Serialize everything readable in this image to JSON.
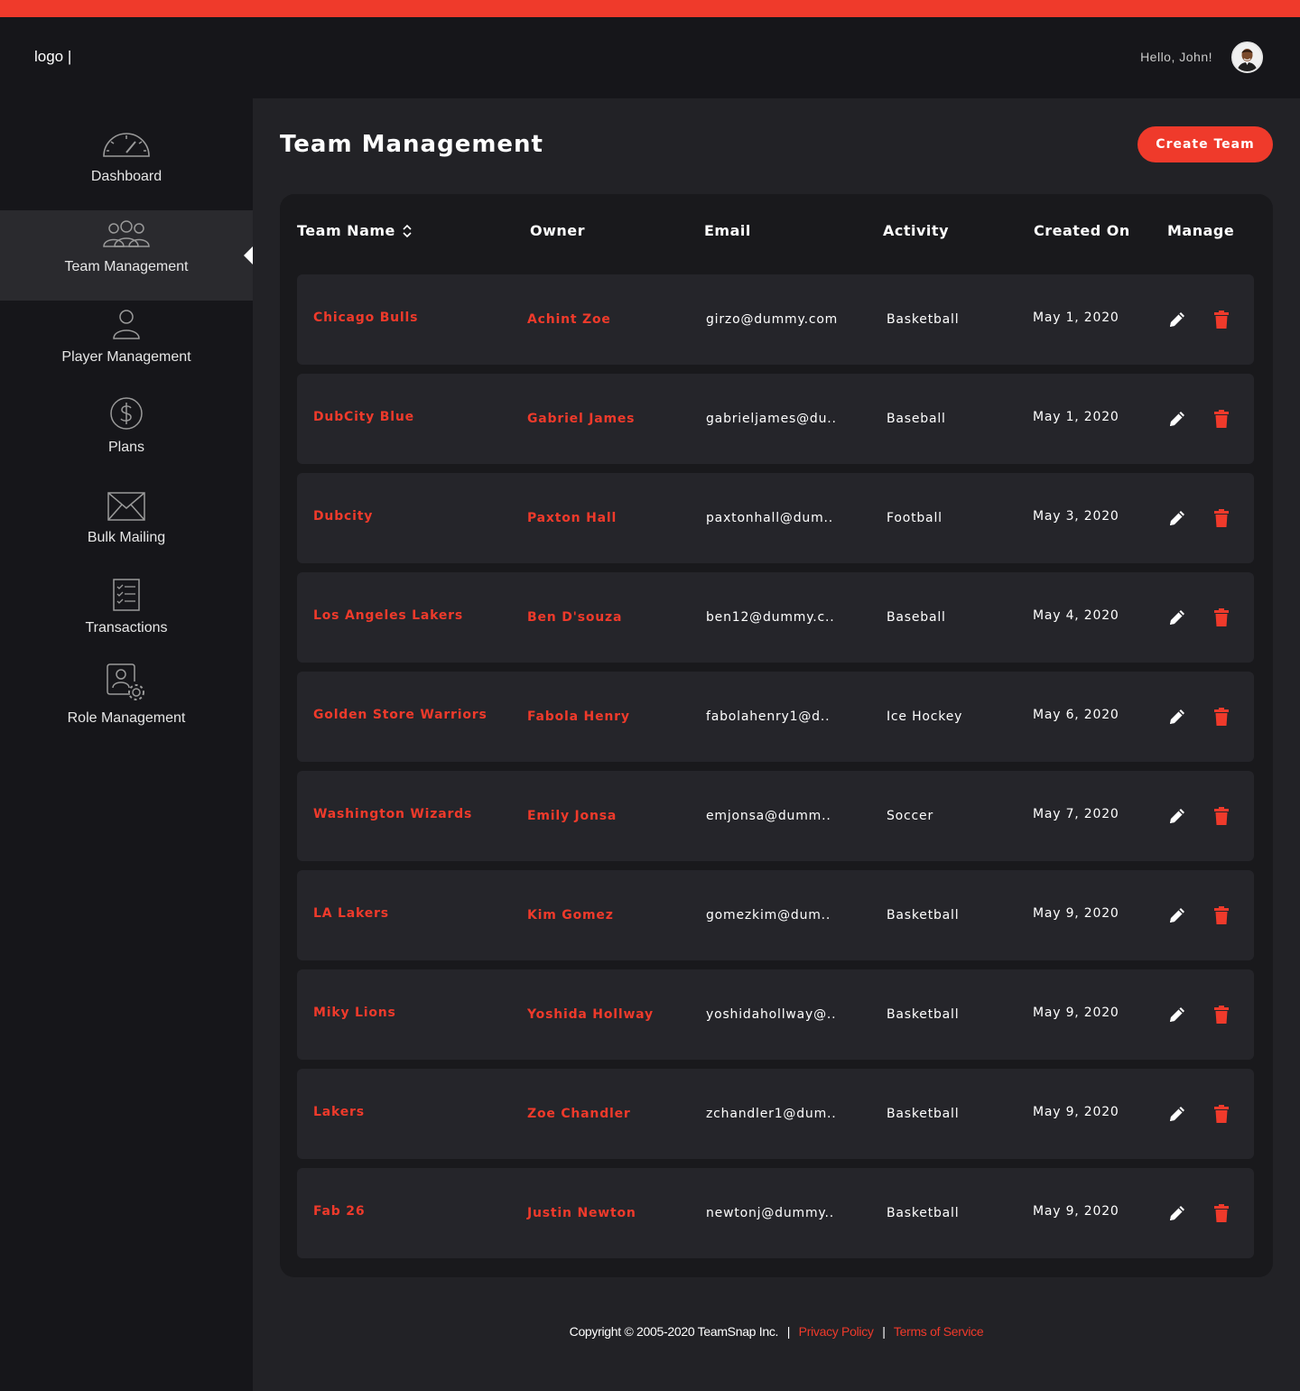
{
  "header": {
    "logo_text": "logo |",
    "greeting": "Hello, John!",
    "accent_color": "#ef3a2b"
  },
  "sidebar": {
    "items": [
      {
        "label": "Dashboard",
        "icon": "speedometer-icon",
        "active": false
      },
      {
        "label": "Team Management",
        "icon": "team-icon",
        "active": true
      },
      {
        "label": "Player Management",
        "icon": "person-icon",
        "active": false
      },
      {
        "label": "Plans",
        "icon": "dollar-icon",
        "active": false
      },
      {
        "label": "Bulk Mailing",
        "icon": "envelope-icon",
        "active": false
      },
      {
        "label": "Transactions",
        "icon": "checklist-icon",
        "active": false
      },
      {
        "label": "Role Management",
        "icon": "user-settings-icon",
        "active": false
      }
    ]
  },
  "main": {
    "title": "Team Management",
    "create_button": "Create Team"
  },
  "table": {
    "columns": [
      "Team Name",
      "Owner",
      "Email",
      "Activity",
      "Created On",
      "Manage"
    ],
    "rows": [
      {
        "team": "Chicago Bulls",
        "owner": "Achint Zoe",
        "email": "girzo@dummy.com",
        "activity": "Basketball",
        "created": "May 1, 2020"
      },
      {
        "team": "DubCity Blue",
        "owner": "Gabriel James",
        "email": "gabrieljames@du..",
        "activity": "Baseball",
        "created": "May 1, 2020"
      },
      {
        "team": "Dubcity",
        "owner": "Paxton Hall",
        "email": "paxtonhall@dum..",
        "activity": "Football",
        "created": "May 3, 2020"
      },
      {
        "team": "Los Angeles Lakers",
        "owner": "Ben D'souza",
        "email": "ben12@dummy.c..",
        "activity": "Baseball",
        "created": "May 4, 2020"
      },
      {
        "team": "Golden Store Warriors",
        "owner": "Fabola Henry",
        "email": "fabolahenry1@d..",
        "activity": "Ice Hockey",
        "created": "May 6, 2020"
      },
      {
        "team": "Washington Wizards",
        "owner": "Emily Jonsa",
        "email": "emjonsa@dumm..",
        "activity": "Soccer",
        "created": "May 7, 2020"
      },
      {
        "team": "LA Lakers",
        "owner": "Kim Gomez",
        "email": "gomezkim@dum..",
        "activity": "Basketball",
        "created": "May 9, 2020"
      },
      {
        "team": "Miky Lions",
        "owner": "Yoshida Hollway",
        "email": "yoshidahollway@..",
        "activity": "Basketball",
        "created": "May 9, 2020"
      },
      {
        "team": "Lakers",
        "owner": "Zoe Chandler",
        "email": "zchandler1@dum..",
        "activity": "Basketball",
        "created": "May 9, 2020"
      },
      {
        "team": "Fab 26",
        "owner": "Justin Newton",
        "email": "newtonj@dummy..",
        "activity": "Basketball",
        "created": "May 9, 2020"
      }
    ]
  },
  "footer": {
    "copyright": "Copyright © 2005-2020 TeamSnap Inc.",
    "separator": "|",
    "privacy": "Privacy Policy",
    "terms": "Terms of Service"
  }
}
